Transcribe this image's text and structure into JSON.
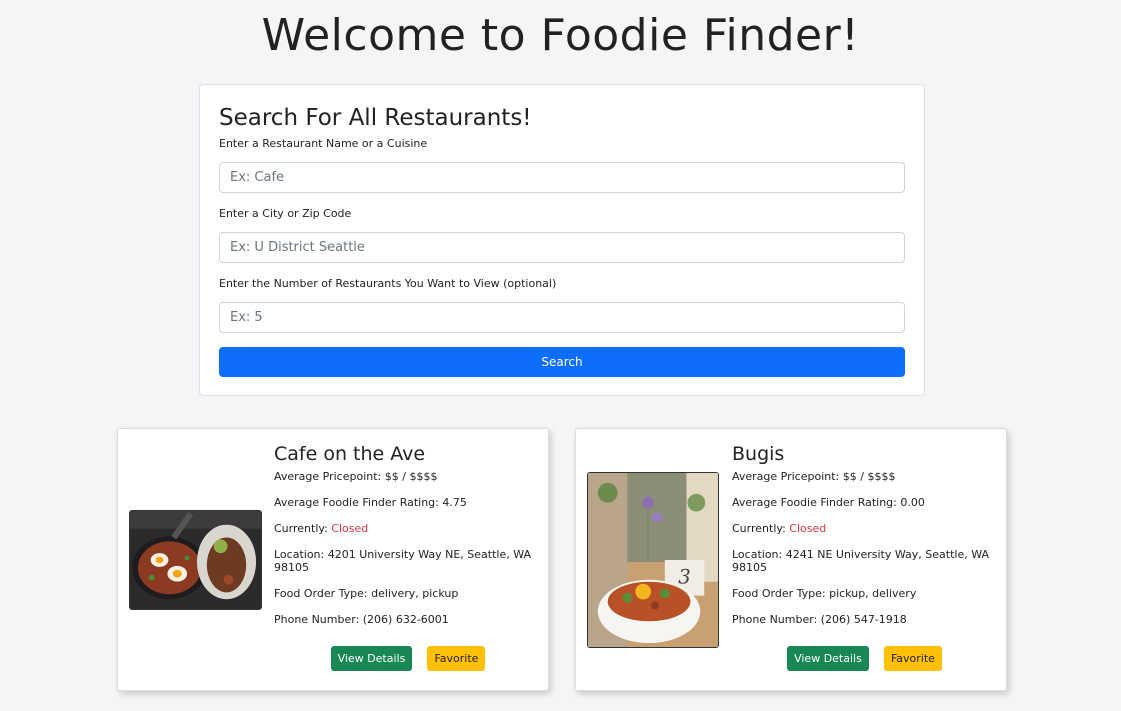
{
  "page": {
    "title": "Welcome to Foodie Finder!"
  },
  "search": {
    "heading": "Search For All Restaurants!",
    "fields": [
      {
        "label": "Enter a Restaurant Name or a Cuisine",
        "placeholder": "Ex: Cafe",
        "value": ""
      },
      {
        "label": "Enter a City or Zip Code",
        "placeholder": "Ex: U District Seattle",
        "value": ""
      },
      {
        "label": "Enter the Number of Restaurants You Want to View (optional)",
        "placeholder": "Ex: 5",
        "value": ""
      }
    ],
    "button_label": "Search",
    "accent_color": "#0d6efd"
  },
  "restaurants": [
    {
      "name": "Cafe on the Ave",
      "pricepoint_label": "Average Pricepoint: $$ / $$$$",
      "rating_label": "Average Foodie Finder Rating: 4.75",
      "status_prefix": "Currently: ",
      "status": "Closed",
      "location_label": "Location: 4201 University Way NE, Seattle, WA 98105",
      "order_type_label": "Food Order Type: delivery, pickup",
      "phone_label": "Phone Number: (206) 632-6001",
      "image_icon": "food-photo-icon",
      "details_label": "View Details",
      "favorite_label": "Favorite"
    },
    {
      "name": "Bugis",
      "pricepoint_label": "Average Pricepoint: $$ / $$$$",
      "rating_label": "Average Foodie Finder Rating: 0.00",
      "status_prefix": "Currently: ",
      "status": "Closed",
      "location_label": "Location: 4241 NE University Way, Seattle, WA 98105",
      "order_type_label": "Food Order Type: pickup, delivery",
      "phone_label": "Phone Number: (206) 547-1918",
      "image_icon": "food-photo-icon",
      "image_text": "3",
      "details_label": "View Details",
      "favorite_label": "Favorite"
    }
  ],
  "colors": {
    "closed": "#dc3545",
    "details_button": "#198754",
    "favorite_button": "#ffc107"
  }
}
